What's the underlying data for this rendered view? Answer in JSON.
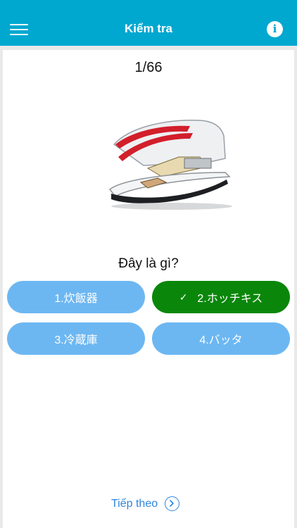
{
  "header": {
    "title": "Kiểm tra",
    "menu_icon": "hamburger-menu-icon",
    "info_label": "i"
  },
  "quiz": {
    "counter": "1/66",
    "question": "Đây là gì?",
    "image_subject": "stapler-illustration",
    "answers": [
      {
        "label": "1.炊飯器",
        "selected": false
      },
      {
        "label": "2.ホッチキス",
        "selected": true,
        "check": "✓"
      },
      {
        "label": "3.冷蔵庫",
        "selected": false
      },
      {
        "label": "4.バッタ",
        "selected": false
      }
    ],
    "next_label": "Tiếp theo",
    "next_icon": "chevron-right-circle-icon"
  },
  "colors": {
    "header": "#00a8d0",
    "answer_default": "#6cb7f2",
    "answer_correct": "#0a870a",
    "link": "#2e86de"
  }
}
